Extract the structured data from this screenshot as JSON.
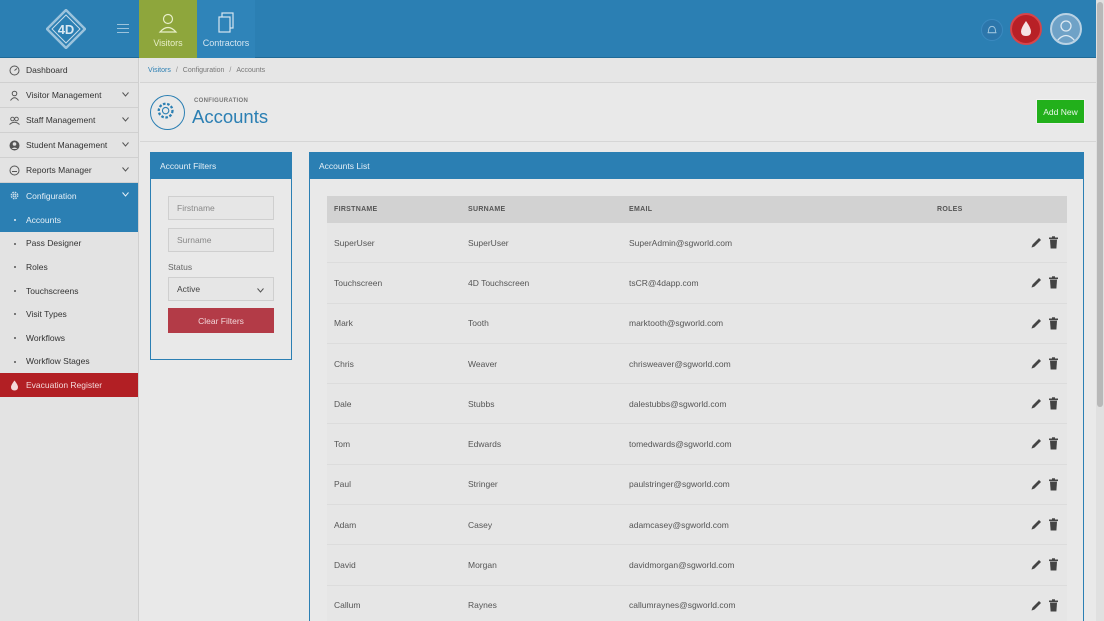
{
  "header": {
    "tabs": [
      {
        "label": "Visitors",
        "icon": "visitor-icon",
        "active": true
      },
      {
        "label": "Contractors",
        "icon": "document-icon",
        "active": false
      }
    ],
    "colors": {
      "primary": "#2b7fb3",
      "active_tab": "#8ea63c",
      "alert": "#b82026"
    }
  },
  "sidebar": {
    "items": [
      {
        "label": "Dashboard",
        "icon": "dashboard-icon"
      },
      {
        "label": "Visitor Management",
        "icon": "visitor-icon"
      },
      {
        "label": "Staff Management",
        "icon": "staff-icon"
      },
      {
        "label": "Student Management",
        "icon": "student-icon"
      },
      {
        "label": "Reports Manager",
        "icon": "reports-icon"
      },
      {
        "label": "Configuration",
        "icon": "gear-icon",
        "active": true
      }
    ],
    "sub_items": [
      {
        "label": "Accounts",
        "active": true
      },
      {
        "label": "Pass Designer"
      },
      {
        "label": "Roles"
      },
      {
        "label": "Touchscreens"
      },
      {
        "label": "Visit Types"
      },
      {
        "label": "Workflows"
      },
      {
        "label": "Workflow Stages"
      }
    ],
    "evacuation": {
      "label": "Evacuation Register",
      "icon": "flame-icon"
    }
  },
  "breadcrumb": {
    "root": "Visitors",
    "middle": "Configuration",
    "current": "Accounts"
  },
  "page": {
    "kicker": "CONFIGURATION",
    "title": "Accounts",
    "add_button": "Add New"
  },
  "filters": {
    "title": "Account Filters",
    "firstname_placeholder": "Firstname",
    "surname_placeholder": "Surname",
    "status_label": "Status",
    "status_value": "Active",
    "clear_button": "Clear Filters"
  },
  "accounts": {
    "title": "Accounts List",
    "columns": [
      "FIRSTNAME",
      "SURNAME",
      "EMAIL",
      "ROLES"
    ],
    "rows": [
      {
        "firstname": "SuperUser",
        "surname": "SuperUser",
        "email": "SuperAdmin@sgworld.com"
      },
      {
        "firstname": "Touchscreen",
        "surname": "4D Touchscreen",
        "email": "tsCR@4dapp.com"
      },
      {
        "firstname": "Mark",
        "surname": "Tooth",
        "email": "marktooth@sgworld.com"
      },
      {
        "firstname": "Chris",
        "surname": "Weaver",
        "email": "chrisweaver@sgworld.com"
      },
      {
        "firstname": "Dale",
        "surname": "Stubbs",
        "email": "dalestubbs@sgworld.com"
      },
      {
        "firstname": "Tom",
        "surname": "Edwards",
        "email": "tomedwards@sgworld.com"
      },
      {
        "firstname": "Paul",
        "surname": "Stringer",
        "email": "paulstringer@sgworld.com"
      },
      {
        "firstname": "Adam",
        "surname": "Casey",
        "email": "adamcasey@sgworld.com"
      },
      {
        "firstname": "David",
        "surname": "Morgan",
        "email": "davidmorgan@sgworld.com"
      },
      {
        "firstname": "Callum",
        "surname": "Raynes",
        "email": "callumraynes@sgworld.com"
      }
    ]
  }
}
